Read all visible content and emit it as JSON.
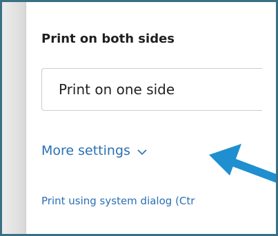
{
  "print_settings": {
    "duplex_label": "Print on both sides",
    "duplex_value": "Print on one side",
    "more_settings_label": "More settings",
    "system_dialog_label": "Print using system dialog (Ctr"
  },
  "icons": {
    "chevron": "chevron-down-icon",
    "arrow": "pointer-arrow-icon"
  },
  "colors": {
    "link": "#2a6fb5",
    "arrow": "#1f8fcf",
    "frame": "#3a6f84"
  }
}
